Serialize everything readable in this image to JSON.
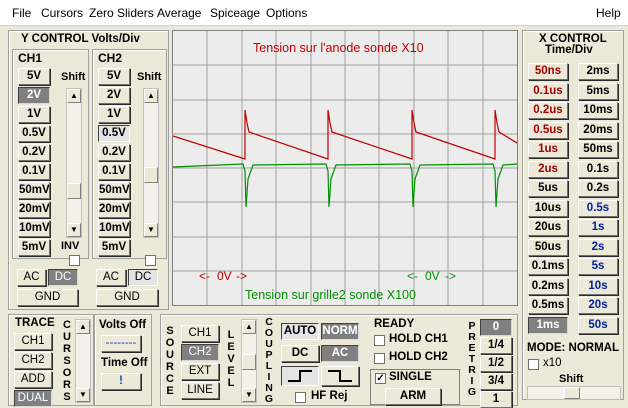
{
  "menu": [
    "File",
    "Cursors",
    "Zero Sliders",
    "Average",
    "Spiceage",
    "Options",
    "Help"
  ],
  "y_control": {
    "title": "Y CONTROL Volts/Div",
    "ch1_label": "CH1",
    "ch2_label": "CH2",
    "shift_label": "Shift",
    "inv_label": "INV",
    "volt_buttons": [
      "5V",
      "2V",
      "1V",
      "0.5V",
      "0.2V",
      "0.1V",
      "50mV",
      "20mV",
      "10mV",
      "5mV"
    ],
    "ch1_selected": "2V",
    "ch2_selected": "0.5V",
    "coupling_ac": "AC",
    "coupling_dc": "DC",
    "gnd": "GND"
  },
  "scope": {
    "ch1_caption": "Tension sur l'anode sonde X10",
    "ch2_caption": "Tension sur grille2  sonde X100",
    "ch1_zero_marker": "0V",
    "ch2_zero_marker": "0V",
    "ch1_color": "#c00000",
    "ch2_color": "#009000",
    "grid_color": "#a0a0a0"
  },
  "x_control": {
    "title_line1": "X CONTROL",
    "title_line2": "Time/Div",
    "left_col": [
      "50ns",
      "0.1us",
      "0.2us",
      "0.5us",
      "1us",
      "2us",
      "5us",
      "10us",
      "20us",
      "50us",
      "0.1ms",
      "0.2ms",
      "0.5ms",
      "1ms"
    ],
    "right_col": [
      "2ms",
      "5ms",
      "10ms",
      "20ms",
      "50ms",
      "0.1s",
      "0.2s",
      "0.5s",
      "1s",
      "2s",
      "5s",
      "10s",
      "20s",
      "50s"
    ],
    "left_red": [
      "50ns",
      "0.1us",
      "0.2us",
      "0.5us",
      "1us",
      "2us"
    ],
    "right_blue": [
      "0.5s",
      "1s",
      "2s",
      "5s",
      "10s",
      "20s",
      "50s"
    ],
    "selected": "1ms",
    "mode_label": "MODE: NORMAL",
    "x10_label": "x10",
    "shift_label": "Shift"
  },
  "trace": {
    "title": "TRACE",
    "buttons": [
      "CH1",
      "CH2",
      "ADD",
      "DUAL"
    ],
    "selected": "DUAL",
    "cursors_vertical": "CURSORS"
  },
  "cursors_panel": {
    "volts_off": "Volts Off",
    "volts_value": "--------",
    "time_off": "Time Off",
    "time_value": "!"
  },
  "trigger": {
    "source_vertical": "SOURCE",
    "source_buttons": [
      "CH1",
      "CH2",
      "EXT",
      "LINE"
    ],
    "source_selected": "CH2",
    "level_vertical": "LEVEL",
    "coupling_vertical": "COUPLING",
    "auto": "AUTO",
    "norm": "NORM",
    "dc": "DC",
    "ac": "AC",
    "hf_rej": "HF Rej",
    "ready": "READY",
    "hold_ch1": "HOLD CH1",
    "hold_ch2": "HOLD CH2",
    "single": "SINGLE",
    "arm": "ARM",
    "pretrig_vertical": "PRETRIG",
    "pretrig_buttons": [
      "0",
      "1/4",
      "1/2",
      "3/4",
      "1"
    ],
    "pretrig_selected": "0"
  }
}
